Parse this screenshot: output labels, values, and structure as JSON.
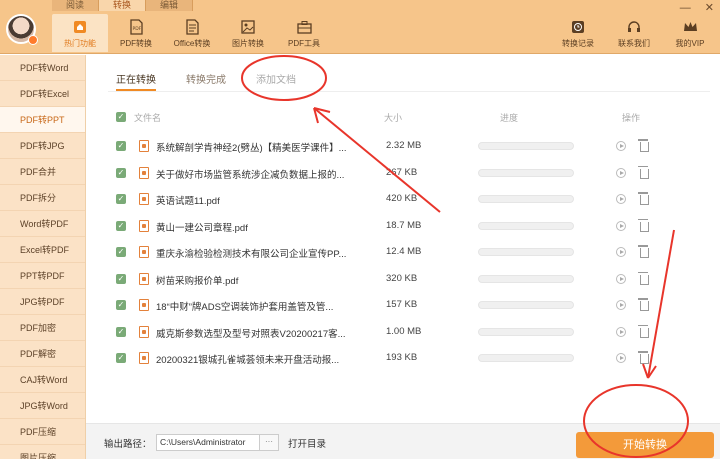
{
  "mode_tabs": [
    "阅读",
    "转换",
    "编辑"
  ],
  "window_controls": {
    "minimize": "—",
    "close": "✕"
  },
  "nav": [
    {
      "label": "热门功能",
      "icon": "home-icon"
    },
    {
      "label": "PDF转换",
      "icon": "pdf-icon"
    },
    {
      "label": "Office转换",
      "icon": "office-icon"
    },
    {
      "label": "图片转换",
      "icon": "image-icon"
    },
    {
      "label": "PDF工具",
      "icon": "toolbox-icon"
    }
  ],
  "right_nav": [
    {
      "label": "转换记录",
      "icon": "clock-icon"
    },
    {
      "label": "联系我们",
      "icon": "headset-icon"
    },
    {
      "label": "我的VIP",
      "icon": "crown-icon"
    }
  ],
  "sidebar": [
    "PDF转Word",
    "PDF转Excel",
    "PDF转PPT",
    "PDF转JPG",
    "PDF合并",
    "PDF拆分",
    "Word转PDF",
    "Excel转PDF",
    "PPT转PDF",
    "JPG转PDF",
    "PDF加密",
    "PDF解密",
    "CAJ转Word",
    "JPG转Word",
    "PDF压缩",
    "图片压缩"
  ],
  "sidebar_active": 2,
  "subtabs": {
    "converting": "正在转换",
    "done": "转换完成",
    "add": "添加文档"
  },
  "table": {
    "headers": {
      "filename": "文件名",
      "size": "大小",
      "progress": "进度",
      "actions": "操作"
    },
    "rows": [
      {
        "name": "系统解剖学肯神经2(劈丛)【精美医学课件】...",
        "size": "2.32 MB",
        "progress": 0
      },
      {
        "name": "关于做好市场监管系统涉企减负数据上报的...",
        "size": "267 KB",
        "progress": 0
      },
      {
        "name": "英语试题11.pdf",
        "size": "420 KB",
        "progress": 0
      },
      {
        "name": "黄山一建公司章程.pdf",
        "size": "18.7 MB",
        "progress": 0
      },
      {
        "name": "重庆永渝检验检测技术有限公司企业宣传PP...",
        "size": "12.4 MB",
        "progress": 0
      },
      {
        "name": "树苗采购报价单.pdf",
        "size": "320 KB",
        "progress": 0
      },
      {
        "name": "18“中财”牌ADS空调装饰护套用盖管及管...",
        "size": "157 KB",
        "progress": 0
      },
      {
        "name": "威克斯参数选型及型号对照表V20200217客...",
        "size": "1.00 MB",
        "progress": 0
      },
      {
        "name": "20200321银城孔雀城荟领未来开盘活动报...",
        "size": "193 KB",
        "progress": 0
      }
    ]
  },
  "bottom": {
    "output_label": "输出路径：",
    "path_value": "C:\\Users\\Administrator",
    "more": "···",
    "open_dir": "打开目录",
    "start": "开始转换"
  },
  "colors": {
    "accent": "#f39a3a",
    "topbar": "#f6c58a",
    "sidebar": "#fbe2c6",
    "annotation": "#e8352b"
  }
}
